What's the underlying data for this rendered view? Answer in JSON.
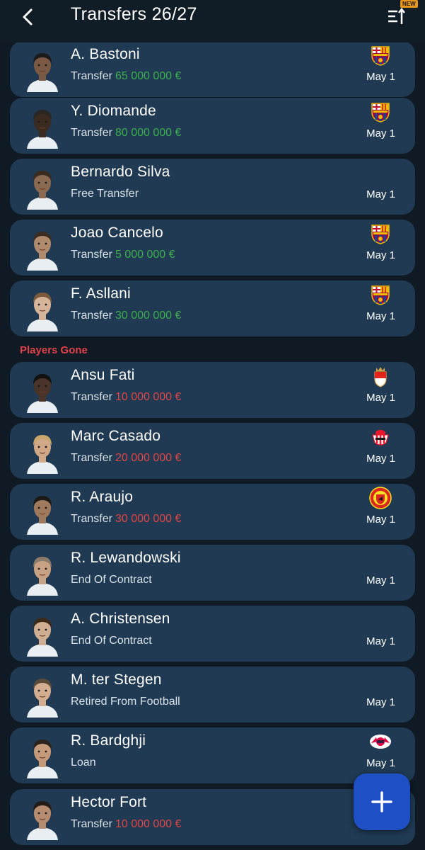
{
  "header": {
    "title": "Transfers 26/27",
    "back_icon": "back-arrow-icon",
    "sort_icon": "sort-lines-icon",
    "new_badge": "NEW"
  },
  "colors": {
    "background": "#0f1a24",
    "card": "#1f3a52",
    "fee_in": "#3dae4e",
    "fee_out": "#e04545",
    "section_heading": "#e0404a",
    "fab": "#1e4fc4"
  },
  "players_in": [
    {
      "name": "A. Bastoni",
      "type": "Transfer",
      "fee": "65 000 000 €",
      "date": "May 1",
      "club_icon": "barcelona-crest-icon"
    },
    {
      "name": "Y. Diomande",
      "type": "Transfer",
      "fee": "80 000 000 €",
      "date": "May 1",
      "club_icon": "barcelona-crest-icon"
    },
    {
      "name": "Bernardo Silva",
      "type": "Free Transfer",
      "fee": "",
      "date": "May 1",
      "club_icon": ""
    },
    {
      "name": "Joao Cancelo",
      "type": "Transfer",
      "fee": "5 000 000 €",
      "date": "May 1",
      "club_icon": "barcelona-crest-icon"
    },
    {
      "name": "F. Asllani",
      "type": "Transfer",
      "fee": "30 000 000 €",
      "date": "May 1",
      "club_icon": "barcelona-crest-icon"
    }
  ],
  "section_gone": "Players Gone",
  "players_gone": [
    {
      "name": "Ansu Fati",
      "type": "Transfer",
      "fee": "10 000 000 €",
      "date": "May 1",
      "club_icon": "monaco-crest-icon"
    },
    {
      "name": "Marc Casado",
      "type": "Transfer",
      "fee": "20 000 000 €",
      "date": "May 1",
      "club_icon": "sunderland-crest-icon"
    },
    {
      "name": "R. Araujo",
      "type": "Transfer",
      "fee": "30 000 000 €",
      "date": "May 1",
      "club_icon": "man-united-crest-icon"
    },
    {
      "name": "R. Lewandowski",
      "type": "End Of Contract",
      "fee": "",
      "date": "May 1",
      "club_icon": ""
    },
    {
      "name": "A. Christensen",
      "type": "End Of Contract",
      "fee": "",
      "date": "May 1",
      "club_icon": ""
    },
    {
      "name": "M. ter Stegen",
      "type": "Retired From Football",
      "fee": "",
      "date": "May 1",
      "club_icon": ""
    },
    {
      "name": "R. Bardghji",
      "type": "Loan",
      "fee": "",
      "date": "May 1",
      "club_icon": "leipzig-crest-icon"
    },
    {
      "name": "Hector Fort",
      "type": "Transfer",
      "fee": "10 000 000 €",
      "date": "May 1",
      "club_icon": ""
    }
  ],
  "fab": {
    "icon": "plus-icon"
  }
}
